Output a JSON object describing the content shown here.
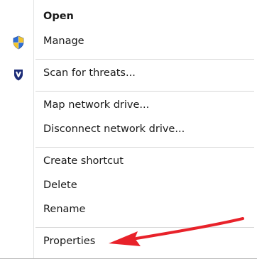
{
  "context_menu": {
    "items": [
      {
        "label": "Open",
        "icon": null
      },
      {
        "label": "Manage",
        "icon": "shield-icon"
      },
      {
        "label": "Scan for threats...",
        "icon": "antivirus-icon"
      },
      {
        "label": "Map network drive...",
        "icon": null
      },
      {
        "label": "Disconnect network drive...",
        "icon": null
      },
      {
        "label": "Create shortcut",
        "icon": null
      },
      {
        "label": "Delete",
        "icon": null
      },
      {
        "label": "Rename",
        "icon": null
      },
      {
        "label": "Properties",
        "icon": null
      }
    ]
  },
  "annotation": {
    "arrow_color": "#e8222a",
    "points_to": "Properties"
  },
  "colors": {
    "menu_background": "#ffffff",
    "separator": "#d8d8d8",
    "shield_blue": "#2f6fd6",
    "shield_yellow": "#f2c42c",
    "antivirus_navy": "#1d2d78"
  }
}
